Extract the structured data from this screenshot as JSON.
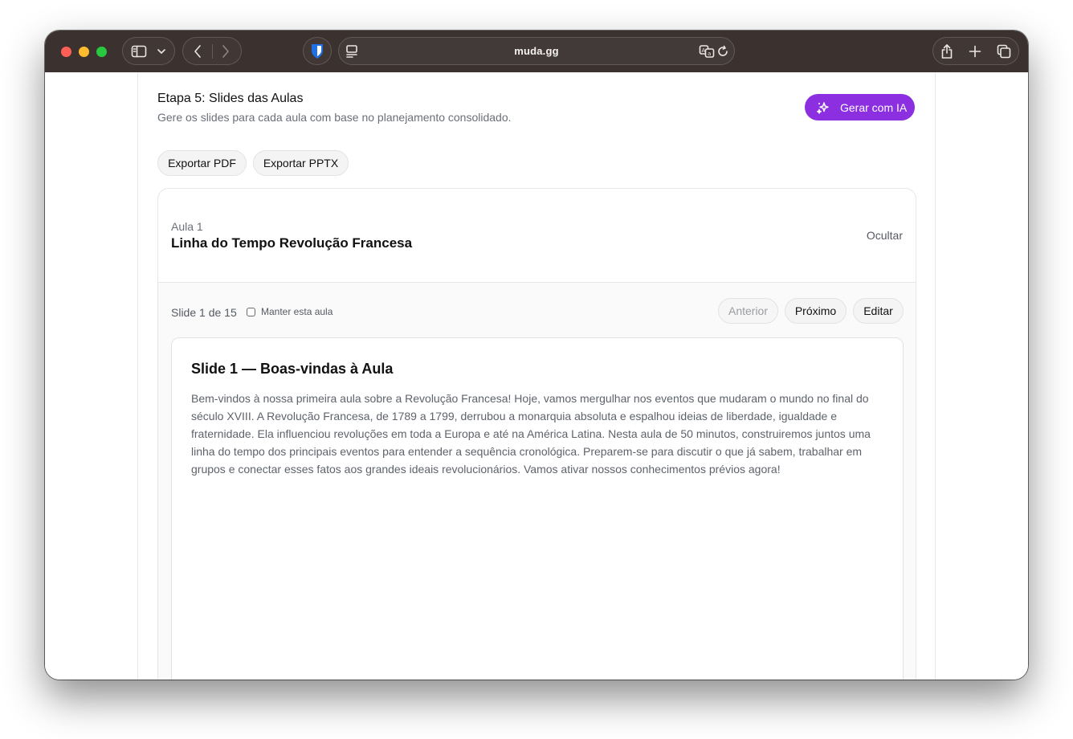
{
  "browser": {
    "url": "muda.gg",
    "icons": [
      "sidebar-icon",
      "chevron-down-icon",
      "back-icon",
      "forward-icon",
      "bitwarden-icon",
      "reader-icon",
      "translate-icon",
      "reload-icon",
      "share-icon",
      "new-tab-icon",
      "tabs-overview-icon"
    ]
  },
  "step": {
    "title": "Etapa 5: Slides das Aulas",
    "subtitle": "Gere os slides para cada aula com base no planejamento consolidado.",
    "generate_label": "Gerar com IA",
    "accent_color": "#8b2fe0"
  },
  "export": {
    "pdf_label": "Exportar PDF",
    "pptx_label": "Exportar PPTX"
  },
  "lesson": {
    "label": "Aula 1",
    "title": "Linha do Tempo Revolução Francesa",
    "hide_label": "Ocultar",
    "slide_counter": "Slide 1 de 15",
    "keep_label": "Manter esta aula",
    "prev_label": "Anterior",
    "next_label": "Próximo",
    "edit_label": "Editar"
  },
  "slide": {
    "title": "Slide 1 — Boas-vindas à Aula",
    "body": "Bem-vindos à nossa primeira aula sobre a Revolução Francesa! Hoje, vamos mergulhar nos eventos que mudaram o mundo no final do século XVIII. A Revolução Francesa, de 1789 a 1799, derrubou a monarquia absoluta e espalhou ideias de liberdade, igualdade e fraternidade. Ela influenciou revoluções em toda a Europa e até na América Latina. Nesta aula de 50 minutos, construiremos juntos uma linha do tempo dos principais eventos para entender a sequência cronológica. Preparem-se para discutir o que já sabem, trabalhar em grupos e conectar esses fatos aos grandes ideais revolucionários. Vamos ativar nossos conhecimentos prévios agora!"
  }
}
